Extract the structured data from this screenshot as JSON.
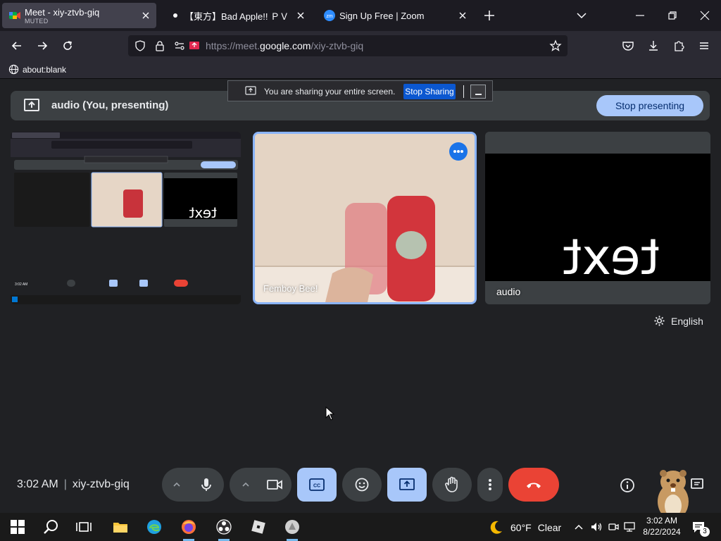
{
  "browser": {
    "tabs": [
      {
        "title": "Meet - xiy-ztvb-giq",
        "subtitle": "MUTED",
        "active": true
      },
      {
        "title": "【東方】Bad Apple!! ＰＶ【影絵】",
        "subtitle": "",
        "active": false
      },
      {
        "title": "Sign Up Free | Zoom",
        "subtitle": "",
        "active": false
      }
    ],
    "url_prefix": "https://meet.",
    "url_domain": "google.com",
    "url_path": "/xiy-ztvb-giq",
    "bookmark": "about:blank"
  },
  "share_banner": {
    "message": "You are sharing your entire screen.",
    "stop_label": "Stop Sharing"
  },
  "present_bar": {
    "label": "audio (You, presenting)",
    "stop_label": "Stop presenting"
  },
  "tiles": {
    "camera_name": "Femboy Bee!",
    "audio_name": "audio",
    "audio_video_text": "text"
  },
  "language": "English",
  "toolbar": {
    "time": "3:02 AM",
    "meeting_code": "xiy-ztvb-giq"
  },
  "taskbar": {
    "temperature": "60°F",
    "condition": "Clear",
    "time": "3:02 AM",
    "date": "8/22/2024",
    "notifications": "3"
  },
  "colors": {
    "accent_blue": "#a8c7fa",
    "end_call_red": "#ea4335",
    "surface": "#3c4043",
    "background": "#202124"
  }
}
